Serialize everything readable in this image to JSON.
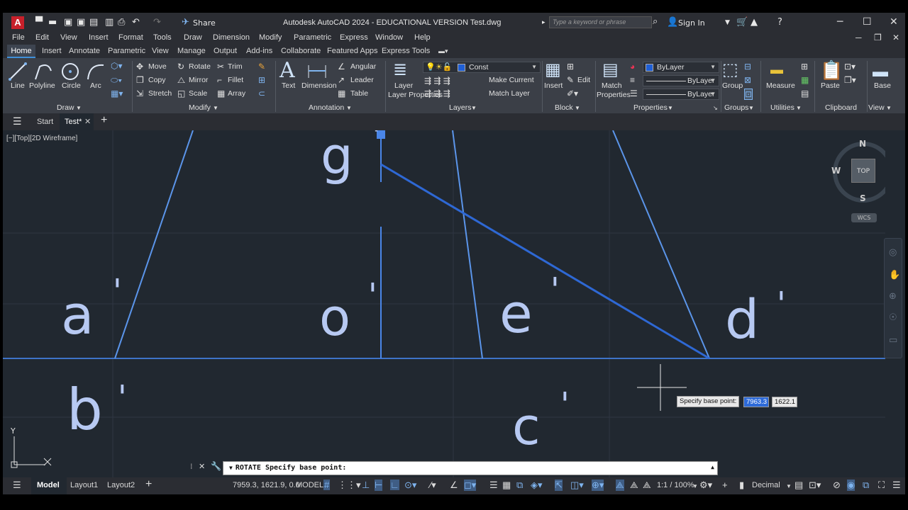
{
  "titlebar": {
    "app_letter": "A",
    "share_label": "Share",
    "title": "Autodesk AutoCAD 2024 - EDUCATIONAL VERSION   Test.dwg",
    "search_placeholder": "Type a keyword or phrase",
    "sign_in": "Sign In"
  },
  "menu": [
    "File",
    "Edit",
    "View",
    "Insert",
    "Format",
    "Tools",
    "Draw",
    "Dimension",
    "Modify",
    "Parametric",
    "Express",
    "Window",
    "Help"
  ],
  "ribbon_tabs": [
    "Home",
    "Insert",
    "Annotate",
    "Parametric",
    "View",
    "Manage",
    "Output",
    "Add-ins",
    "Collaborate",
    "Featured Apps",
    "Express Tools"
  ],
  "draw": {
    "line": "Line",
    "polyline": "Polyline",
    "circle": "Circle",
    "arc": "Arc",
    "panel": "Draw"
  },
  "modify": {
    "move": "Move",
    "copy": "Copy",
    "stretch": "Stretch",
    "rotate": "Rotate",
    "mirror": "Mirror",
    "scale": "Scale",
    "trim": "Trim",
    "fillet": "Fillet",
    "array": "Array",
    "panel": "Modify"
  },
  "annotation": {
    "text": "Text",
    "dimension": "Dimension",
    "angular": "Angular",
    "leader": "Leader",
    "table": "Table",
    "panel": "Annotation"
  },
  "layers": {
    "layer_properties": "Layer Properties",
    "current_layer": "Const",
    "make_current": "Make Current",
    "match_layer": "Match Layer",
    "panel": "Layers"
  },
  "block": {
    "insert": "Insert",
    "edit": "Edit",
    "panel": "Block"
  },
  "properties": {
    "match": "Match Properties",
    "color": "ByLayer",
    "linetype": "ByLayer",
    "lineweight": "ByLayer",
    "panel": "Properties"
  },
  "groups": {
    "group": "Group",
    "panel": "Groups"
  },
  "utilities": {
    "measure": "Measure",
    "panel": "Utilities"
  },
  "clipboard": {
    "paste": "Paste",
    "panel": "Clipboard"
  },
  "view_panel": {
    "base": "Base",
    "panel": "View"
  },
  "file_tabs": {
    "start": "Start",
    "active": "Test*"
  },
  "viewport": {
    "label": "[−][Top][2D Wireframe]",
    "labels": {
      "g": "g",
      "a": "a",
      "o": "o",
      "e": "e",
      "d": "d",
      "b": "b",
      "c": "c"
    },
    "viewcube": {
      "n": "N",
      "s": "S",
      "e": "E",
      "w": "W",
      "top": "TOP",
      "wcs": "WCS"
    },
    "ucs_y": "Y",
    "tooltip": {
      "prompt": "Specify base point:",
      "x": "7963.3",
      "y": "1622.1"
    }
  },
  "command": {
    "text": "ROTATE Specify base point:"
  },
  "status": {
    "model_tab": "Model",
    "layout1": "Layout1",
    "layout2": "Layout2",
    "coords": "7959.3, 1621.9, 0.0",
    "model": "MODEL",
    "scale": "1:1 / 100%",
    "units": "Decimal"
  },
  "colors": {
    "accent": "#3f8fd9",
    "line_blue": "#4a86e8",
    "glyph": "#b7c9f2"
  }
}
